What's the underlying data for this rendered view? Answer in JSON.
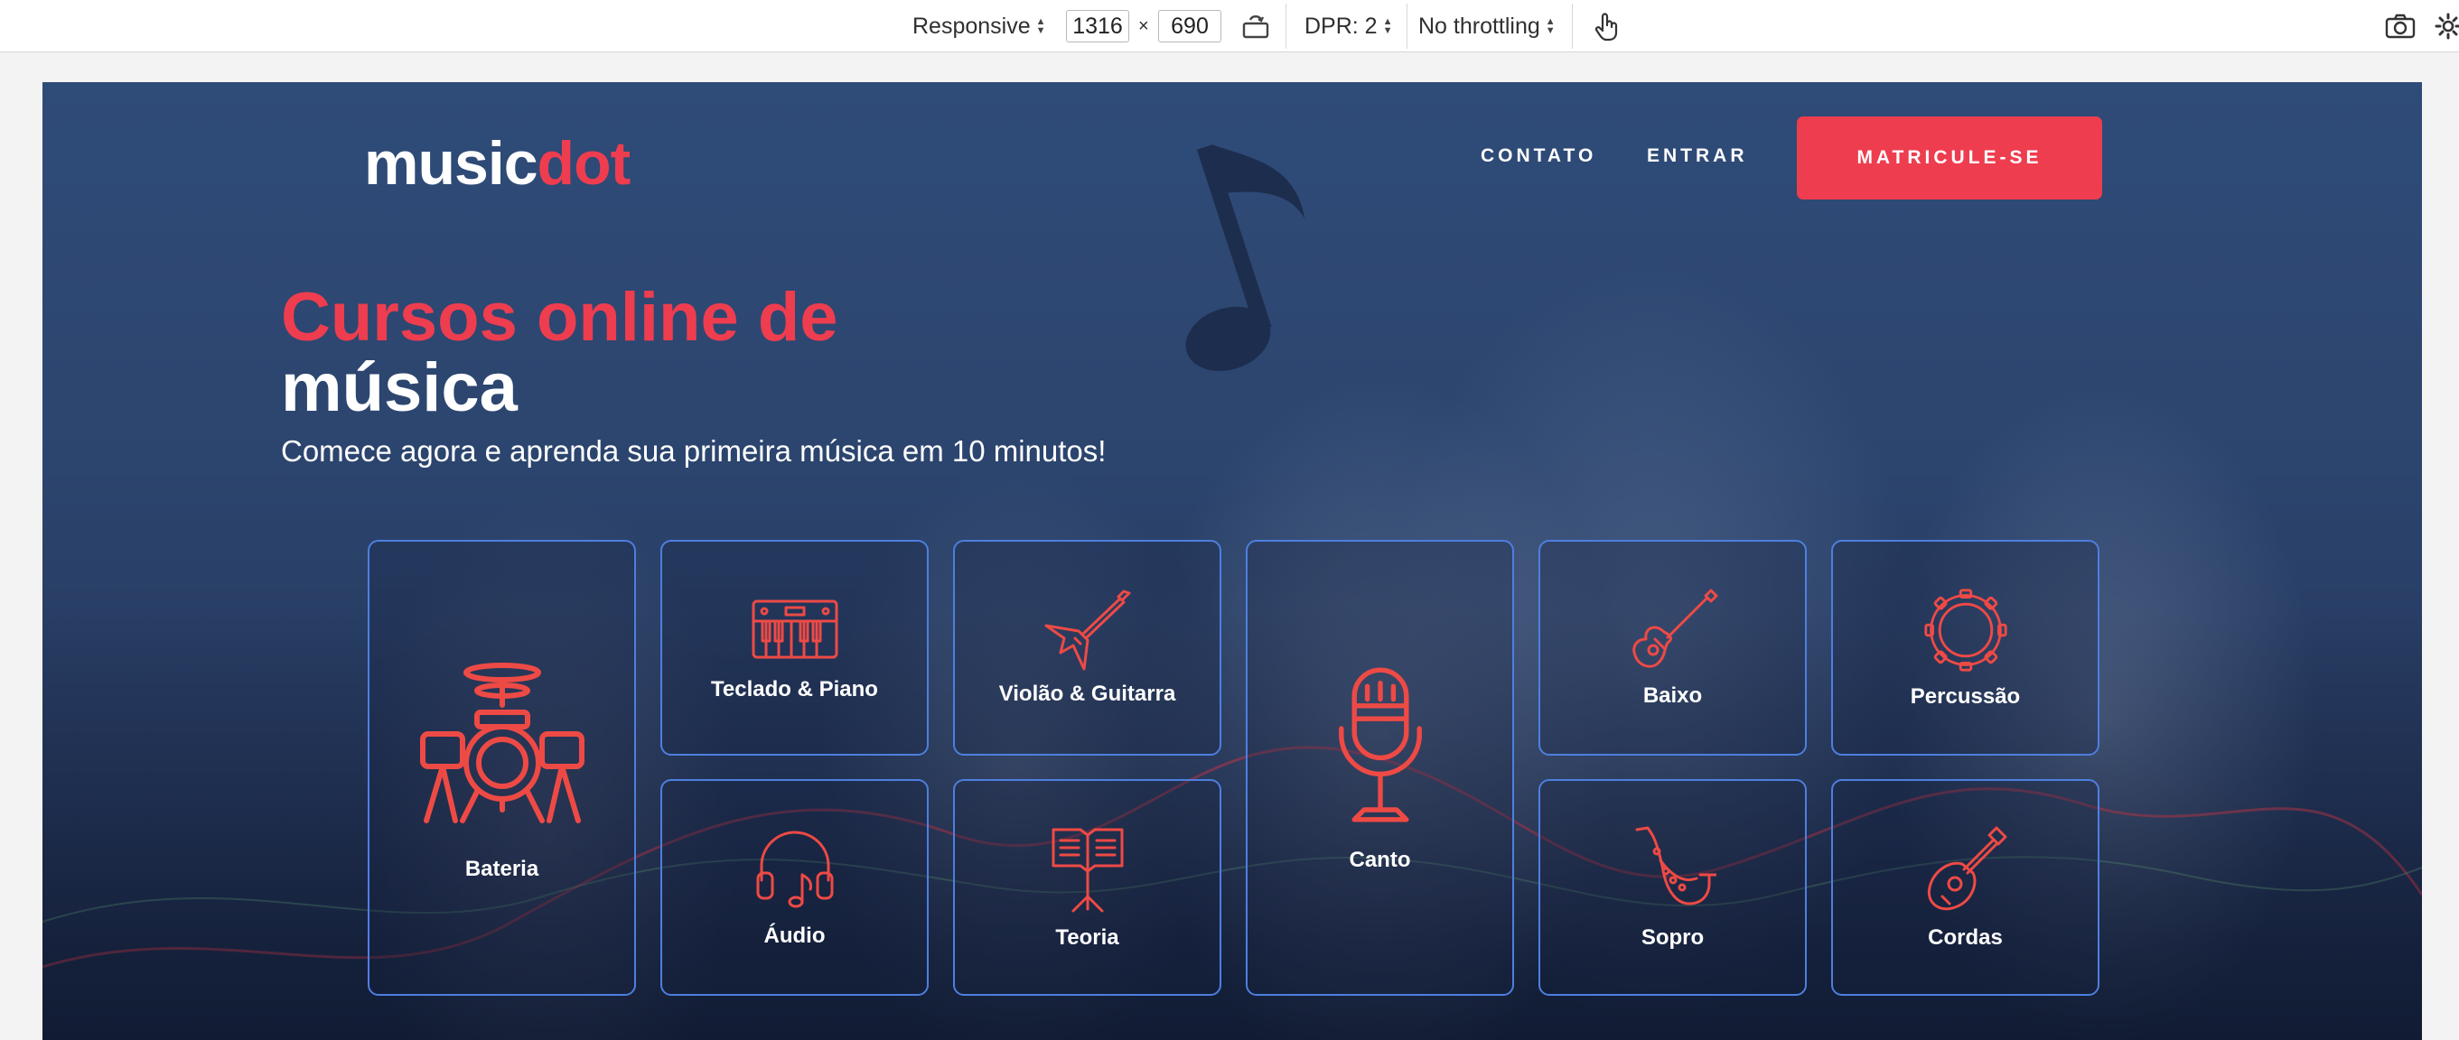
{
  "devtools": {
    "device_mode": "Responsive",
    "width": "1316",
    "times": "×",
    "height": "690",
    "dpr": "DPR: 2",
    "throttling": "No throttling"
  },
  "site": {
    "logo_part1": "music",
    "logo_part2": "dot",
    "nav": {
      "contact": "CONTATO",
      "login": "ENTRAR",
      "enroll": "MATRICULE-SE"
    },
    "hero": {
      "title_line1": "Cursos online de",
      "title_line2": "música",
      "subtitle": "Comece agora e aprenda sua primeira música em 10 minutos!"
    },
    "courses": [
      {
        "label": "Bateria",
        "icon": "drum-kit-icon"
      },
      {
        "label": "Teclado & Piano",
        "icon": "keyboard-icon"
      },
      {
        "label": "Violão & Guitarra",
        "icon": "electric-guitar-icon"
      },
      {
        "label": "Canto",
        "icon": "microphone-icon"
      },
      {
        "label": "Baixo",
        "icon": "bass-guitar-icon"
      },
      {
        "label": "Percussão",
        "icon": "tambourine-icon"
      },
      {
        "label": "Áudio",
        "icon": "headphones-icon"
      },
      {
        "label": "Teoria",
        "icon": "music-stand-icon"
      },
      {
        "label": "Sopro",
        "icon": "saxophone-icon"
      },
      {
        "label": "Cordas",
        "icon": "mandolin-icon"
      }
    ],
    "colors": {
      "accent": "#ee3d4f",
      "card_border": "#4d7fe0",
      "hero_bg": "#2c456e"
    }
  }
}
